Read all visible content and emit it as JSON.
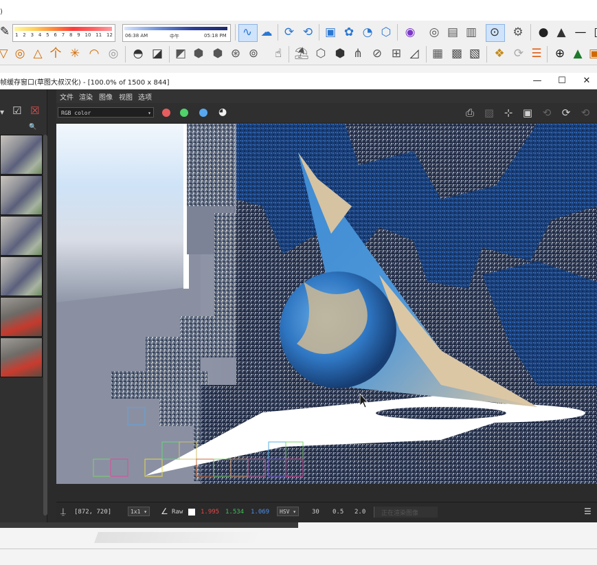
{
  "app": {
    "corner_text": ")"
  },
  "toolbar1": {
    "color_scale_labels": [
      "1",
      "2",
      "3",
      "4",
      "5",
      "6",
      "7",
      "8",
      "9",
      "10",
      "11",
      "12"
    ],
    "time_left": "06:38 AM",
    "time_mid": "中午",
    "time_right": "05:18 PM",
    "icons": [
      "wireframe-icon",
      "render-setup-icon",
      "interactive-render-icon",
      "active-shade-icon",
      "render-frame-icon",
      "material-editor-icon",
      "sun-icon",
      "viewport-icon",
      "render-region-icon",
      "object-settings-icon",
      "light-lister-icon",
      "camera-settings-icon",
      "ipr-icon",
      "settings-icon",
      "light-icon",
      "cone-light-icon",
      "minimize-icon"
    ]
  },
  "toolbar2": {
    "icons": [
      "plane-icon",
      "sphere-icon",
      "triangle-icon",
      "umbrella-icon",
      "sunburst-icon",
      "ellipse-icon",
      "omni-light-icon",
      "material-preview-icon",
      "lightmix-icon",
      "proxy-icon",
      "proxy-box-icon",
      "sphere-mesh-icon",
      "grid-sphere-icon",
      "object-props-icon",
      "hand-tool-icon",
      "dome-light-icon",
      "box-icon",
      "fur-icon",
      "grass-icon",
      "decal-icon",
      "grid-icon",
      "clipper-icon",
      "bake-icon",
      "tile-icon",
      "scatter-icon",
      "refresh-icon",
      "stack-icon",
      "add-icon",
      "tree-icon",
      "palette-icon"
    ]
  },
  "frame_buffer": {
    "title": "帧缓存窗口(草图大叔汉化) - [100.0% of 1500 x 844]",
    "window_controls": {
      "minimize": "—",
      "maximize": "☐",
      "close": "✕"
    },
    "menu": [
      "文件",
      "渲染",
      "图像",
      "视图",
      "选项"
    ],
    "channel": "RGB color",
    "channel_arrow": "▾",
    "channel_dots": {
      "red": "#e85d5d",
      "green": "#4fd36a",
      "blue": "#58a8f0"
    },
    "history_search": "🔍",
    "history_thumbnail_count": 6
  },
  "status": {
    "coords": "[872, 720]",
    "zoom": "1x1",
    "raw_label": "Raw",
    "r_value": "1.995",
    "g_value": "1.534",
    "b_value": "1.069",
    "color_mode": "HSV",
    "v1": "30",
    "v2": "0.5",
    "v3": "2.0",
    "render_status": "正在渲染图像",
    "colors": {
      "r": "#e24a4a",
      "g": "#3fc25a",
      "b": "#4f8fe8"
    }
  }
}
